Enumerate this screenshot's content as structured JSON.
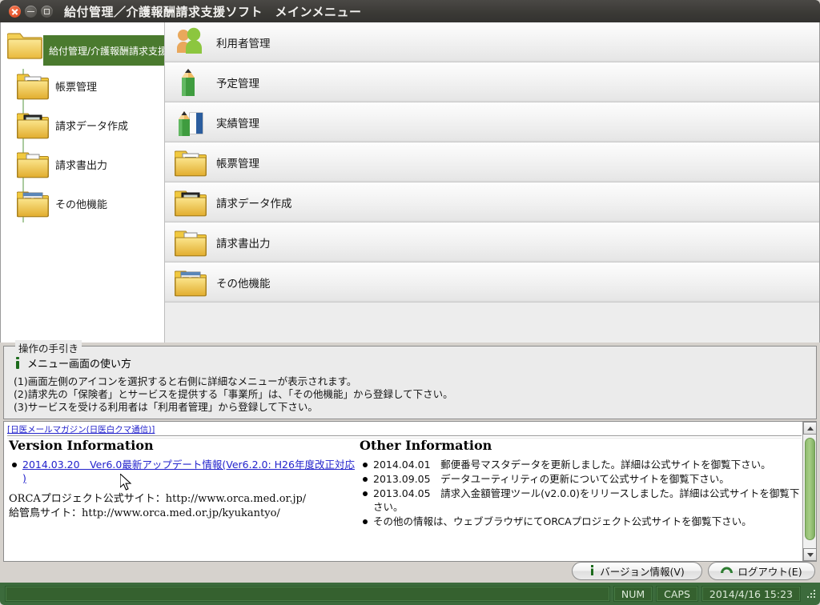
{
  "window": {
    "title": "給付管理／介護報酬請求支援ソフト　メインメニュー",
    "close_icon": "close-icon",
    "minimize_icon": "minimize-icon",
    "maximize_icon": "maximize-icon"
  },
  "tree": {
    "header": {
      "label": "給付管理/介護報酬請求支援",
      "icon": "folder-icon"
    },
    "items": [
      {
        "label": "帳票管理",
        "icon": "folder-document-icon"
      },
      {
        "label": "請求データ作成",
        "icon": "folder-calculator-icon"
      },
      {
        "label": "請求書出力",
        "icon": "folder-printer-icon"
      },
      {
        "label": "その他機能",
        "icon": "folder-table-icon"
      }
    ]
  },
  "menu": {
    "rows": [
      {
        "label": "利用者管理",
        "icon": "people-icon"
      },
      {
        "label": "予定管理",
        "icon": "pencil-icon"
      },
      {
        "label": "実績管理",
        "icon": "pencil-book-icon"
      },
      {
        "label": "帳票管理",
        "icon": "folder-document-icon"
      },
      {
        "label": "請求データ作成",
        "icon": "folder-calculator-icon"
      },
      {
        "label": "請求書出力",
        "icon": "folder-printer-icon"
      },
      {
        "label": "その他機能",
        "icon": "folder-table-icon"
      }
    ]
  },
  "guide": {
    "legend": "操作の手引き",
    "icon": "info-icon",
    "subtitle": "メニュー画面の使い方",
    "lines": [
      "(1)画面左側のアイコンを選択すると右側に詳細なメニューが表示されます。",
      "(2)請求先の「保険者」とサービスを提供する「事業所」は、「その他機能」から登録して下さい。",
      "(3)サービスを受ける利用者は「利用者管理」から登録して下さい。"
    ]
  },
  "info": {
    "top_link": "[日医メールマガジン(日医白クマ通信)]",
    "left": {
      "heading": "Version Information",
      "bullets": [
        {
          "text": "2014.03.20　Ver6.0最新アップデート情報(Ver6.2.0: H26年度改正対応 )",
          "link": true
        }
      ],
      "plain": [
        "ORCAプロジェクト公式サイト：http://www.orca.med.or.jp/",
        "給管鳥サイト：http://www.orca.med.or.jp/kyukantyo/"
      ]
    },
    "right": {
      "heading": "Other Information",
      "bullets": [
        {
          "text": "2014.04.01　郵便番号マスタデータを更新しました。詳細は公式サイトを御覧下さい。",
          "link": false
        },
        {
          "text": "2013.09.05　データユーティリティの更新について公式サイトを御覧下さい。",
          "link": false
        },
        {
          "text": "2013.04.05　請求入金額管理ツール(v2.0.0)をリリースしました。詳細は公式サイトを御覧下さい。",
          "link": false
        },
        {
          "text": "その他の情報は、ウェブブラウザにてORCAプロジェクト公式サイトを御覧下さい。",
          "link": false
        }
      ]
    },
    "scrollbar": {
      "up_icon": "scroll-up-icon",
      "down_icon": "scroll-down-icon",
      "thumb_color": "#8fba6e"
    }
  },
  "buttons": {
    "version": {
      "label": "バージョン情報(V)",
      "accel": "V",
      "icon": "info-icon"
    },
    "logout": {
      "label": "ログアウト(E)",
      "accel": "E",
      "icon": "logout-arc-icon"
    }
  },
  "statusbar": {
    "num": "NUM",
    "caps": "CAPS",
    "datetime": "2014/4/16 15:23",
    "grip_icon": "resize-grip-icon"
  },
  "colors": {
    "titlebar": "#3a3935",
    "accent_green": "#4a7a2e",
    "status_green": "#3c6b3c",
    "link_blue": "#2222cc"
  }
}
